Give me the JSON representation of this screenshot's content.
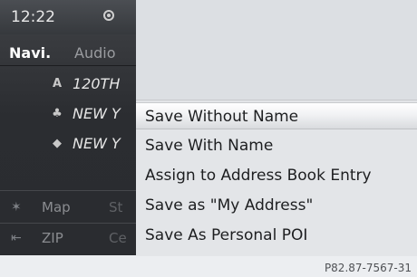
{
  "status": {
    "time": "12:22",
    "icon": "circle-target-icon"
  },
  "tabs": {
    "navi": "Navi.",
    "audio": "Audio"
  },
  "destinations": [
    {
      "icon": "A",
      "icon_name": "letter-a-icon",
      "text": "120TH"
    },
    {
      "icon": "♣",
      "icon_name": "building-icon",
      "text": "NEW Y"
    },
    {
      "icon": "◆",
      "icon_name": "usa-map-icon",
      "text": "NEW Y"
    }
  ],
  "bottom_rows": [
    {
      "icon": "✶",
      "icon_name": "map-person-icon",
      "label": "Map",
      "extra": "St"
    },
    {
      "icon": "⇤",
      "icon_name": "back-icon",
      "label": "ZIP",
      "extra": "Ce"
    }
  ],
  "menu": {
    "items": [
      {
        "label": "Save Without Name",
        "selected": true
      },
      {
        "label": "Save With Name",
        "selected": false
      },
      {
        "label": "Assign to Address Book Entry",
        "selected": false
      },
      {
        "label": "Save as \"My Address\"",
        "selected": false
      },
      {
        "label": "Save As Personal POI",
        "selected": false
      }
    ]
  },
  "footer": {
    "ref": "P82.87-7567-31"
  },
  "colors": {
    "left_panel": "#2b2d31",
    "menu_bg": "#e3e5e8",
    "page_bg": "#eceef1"
  }
}
